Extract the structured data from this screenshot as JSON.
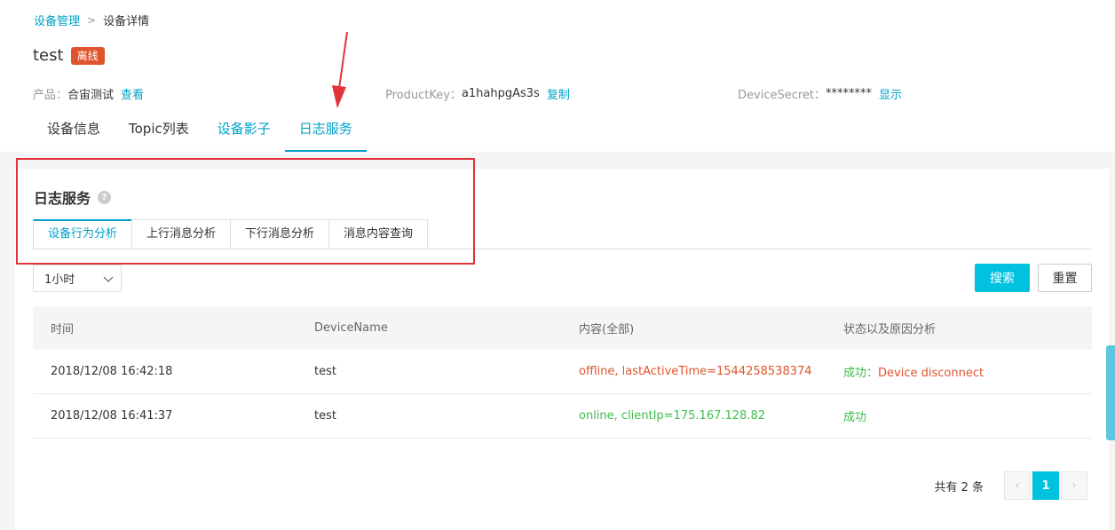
{
  "breadcrumb": {
    "parent": "设备管理",
    "current": "设备详情",
    "separator": ">"
  },
  "device": {
    "name": "test",
    "status": "离线"
  },
  "meta": {
    "product_label": "产品：",
    "product_value": "合宙测试",
    "product_link": "查看",
    "productkey_label": "ProductKey：",
    "productkey_value": "a1hahpgAs3s",
    "productkey_link": "复制",
    "secret_label": "DeviceSecret：",
    "secret_value": "********",
    "secret_link": "显示"
  },
  "tabs": [
    {
      "label": "设备信息"
    },
    {
      "label": "Topic列表"
    },
    {
      "label": "设备影子"
    },
    {
      "label": "日志服务"
    }
  ],
  "section": {
    "title": "日志服务",
    "help_icon": "question-icon",
    "help_glyph": "?"
  },
  "subtabs": [
    {
      "label": "设备行为分析"
    },
    {
      "label": "上行消息分析"
    },
    {
      "label": "下行消息分析"
    },
    {
      "label": "消息内容查询"
    }
  ],
  "filter": {
    "time_range": "1小时"
  },
  "buttons": {
    "search": "搜索",
    "reset": "重置"
  },
  "table": {
    "headers": [
      "时间",
      "DeviceName",
      "内容(全部)",
      "状态以及原因分析"
    ],
    "rows": [
      {
        "time": "2018/12/08 16:42:18",
        "device": "test",
        "content": "offline, lastActiveTime=1544258538374",
        "status": "成功：Device disconnect"
      },
      {
        "time": "2018/12/08 16:41:37",
        "device": "test",
        "content": "online, clientIp=175.167.128.82",
        "status": "成功"
      }
    ]
  },
  "pagination": {
    "total_text": "共有 2 条",
    "current_page": "1",
    "prev": "‹",
    "next": "›"
  },
  "colors": {
    "accent": "#00a2ca",
    "primary_button": "#00c1de",
    "status_offline": "#e0542d",
    "success": "#3dbd4d",
    "annotation": "#e0343a"
  }
}
